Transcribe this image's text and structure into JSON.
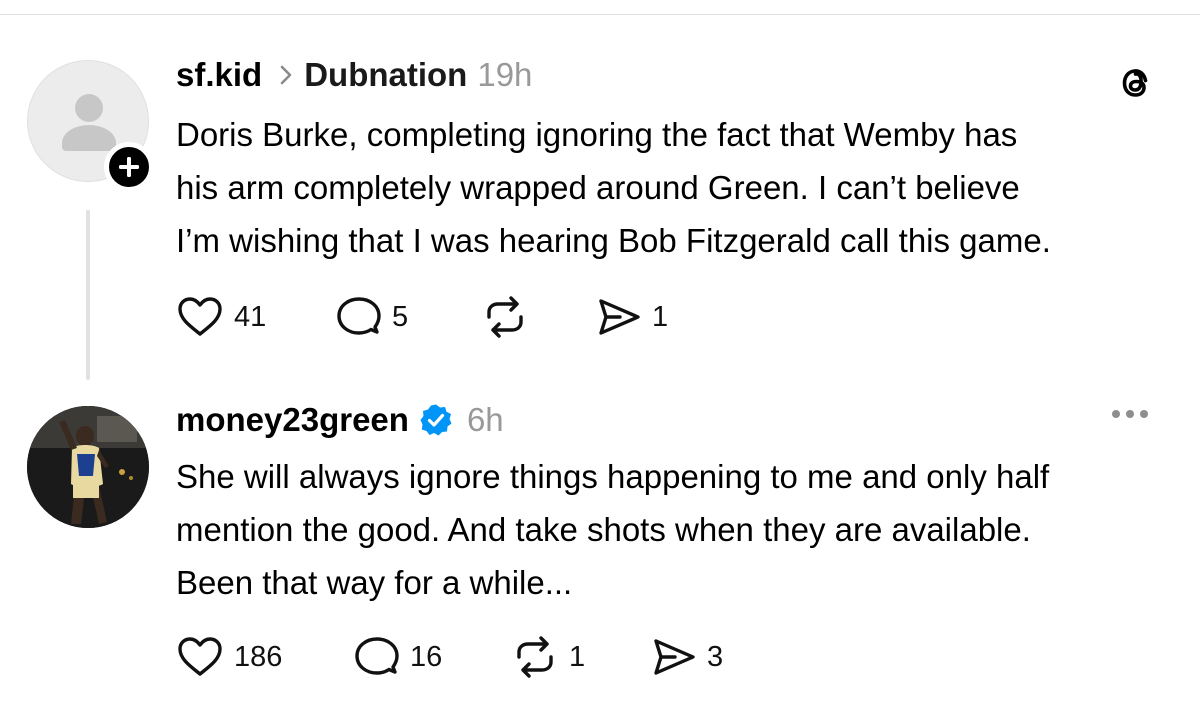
{
  "posts": [
    {
      "username": "sf.kid",
      "community": "Dubnation",
      "time": "19h",
      "text_lines": [
        "Doris Burke, completing ignoring the fact that Wemby has",
        "his arm completely wrapped around Green. I can’t believe",
        "I’m wishing that I was hearing Bob Fitzgerald call this game."
      ],
      "likes": "41",
      "replies": "5",
      "reposts": "",
      "shares": "1"
    },
    {
      "username": "money23green",
      "verified": true,
      "time": "6h",
      "text_lines": [
        "She will always ignore things happening to me and only half",
        "mention the good. And take shots when they are available.",
        "Been that way for a while..."
      ],
      "likes": "186",
      "replies": "16",
      "reposts": "1",
      "shares": "3"
    }
  ],
  "colors": {
    "verified_blue": "#0095f6",
    "muted_text": "#999999",
    "divider": "#e1e1e1"
  },
  "icons": [
    "threads-logo-icon",
    "chevron-right-icon",
    "plus-icon",
    "verified-badge-icon",
    "heart-icon",
    "comment-icon",
    "repost-icon",
    "share-icon",
    "more-icon"
  ]
}
